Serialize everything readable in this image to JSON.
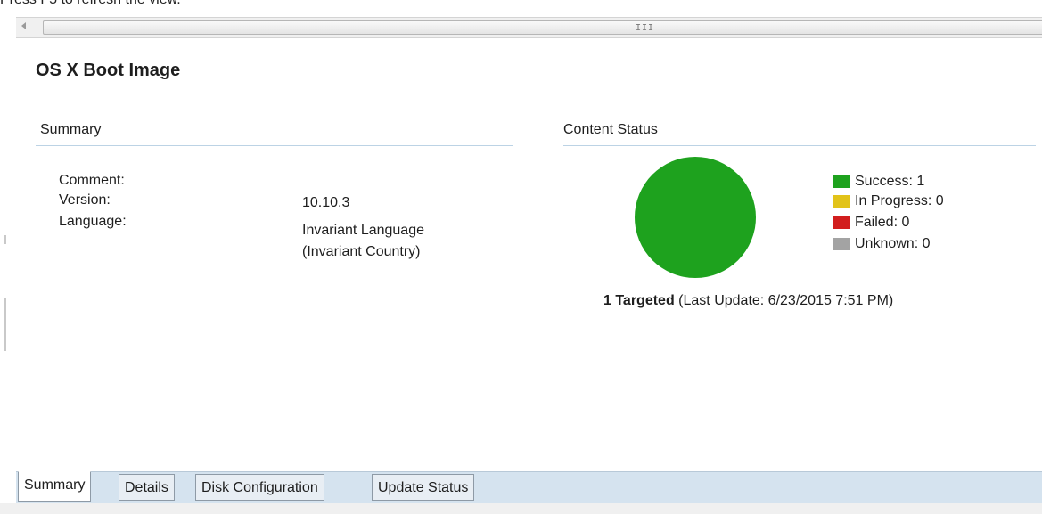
{
  "banner": {
    "text": "Press F5 to refresh the view."
  },
  "scrollbar": {
    "grip": "III"
  },
  "page": {
    "title": "OS X Boot Image"
  },
  "summary": {
    "header": "Summary",
    "rows": [
      {
        "label": "Comment:",
        "value": ""
      },
      {
        "label": "Version:",
        "value": "10.10.3"
      },
      {
        "label": "Language:",
        "value": "Invariant Language",
        "value2": "(Invariant Country)"
      }
    ]
  },
  "content_status": {
    "header": "Content Status",
    "legend": [
      {
        "label": "Success: 1",
        "color": "#1ea21e"
      },
      {
        "label": "In Progress: 0",
        "color": "#e2c319"
      },
      {
        "label": "Failed: 0",
        "color": "#d21e1e"
      },
      {
        "label": "Unknown: 0",
        "color": "#a3a3a3"
      }
    ],
    "targeted_bold": "1 Targeted",
    "targeted_rest": " (Last Update: 6/23/2015 7:51 PM)"
  },
  "chart_data": {
    "type": "pie",
    "categories": [
      "Success",
      "In Progress",
      "Failed",
      "Unknown"
    ],
    "values": [
      1,
      0,
      0,
      0
    ],
    "colors": [
      "#1ea21e",
      "#e2c319",
      "#d21e1e",
      "#a3a3a3"
    ]
  },
  "tabs": [
    {
      "label": "Summary",
      "active": true
    },
    {
      "label": "Details",
      "active": false
    },
    {
      "label": "Disk Configuration",
      "active": false
    },
    {
      "label": "Update Status",
      "active": false
    }
  ]
}
